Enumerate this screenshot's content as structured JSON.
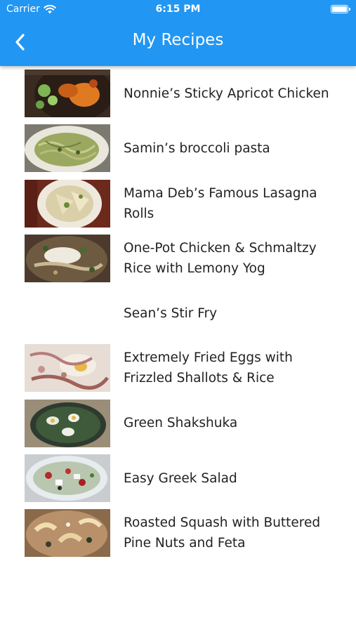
{
  "status_bar": {
    "carrier": "Carrier",
    "time": "6:15 PM",
    "icons": [
      "wifi-icon",
      "battery-icon"
    ]
  },
  "app_bar": {
    "title": "My Recipes",
    "back_icon": "chevron-left-icon",
    "background_color": "#2196f3"
  },
  "recipes": [
    {
      "name": "Nonnie’s Sticky Apricot Chicken",
      "has_photo": true
    },
    {
      "name": "Samin’s broccoli pasta",
      "has_photo": true
    },
    {
      "name": "Mama Deb’s Famous Lasagna Rolls",
      "has_photo": true
    },
    {
      "name": "One-Pot Chicken & Schmaltzy Rice with Lemony Yog",
      "has_photo": true
    },
    {
      "name": "Sean’s Stir Fry",
      "has_photo": false
    },
    {
      "name": "Extremely Fried Eggs with Frizzled Shallots & Rice",
      "has_photo": true
    },
    {
      "name": "Green Shakshuka",
      "has_photo": true
    },
    {
      "name": "Easy Greek Salad",
      "has_photo": true
    },
    {
      "name": "Roasted Squash with Buttered Pine Nuts and Feta",
      "has_photo": true
    }
  ]
}
